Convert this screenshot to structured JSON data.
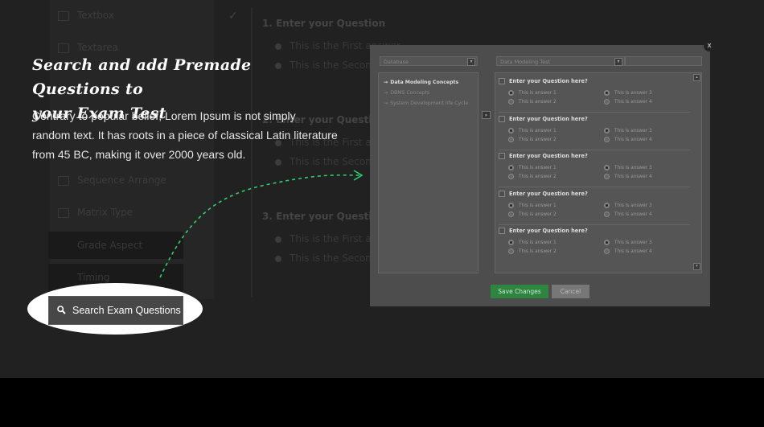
{
  "headline": {
    "line1": "Search and add Premade Questions to",
    "line2": "your Exam Test"
  },
  "description": {
    "line1": "Contrary to popular belief, Lorem Ipsum is not simply",
    "line2": "random text. It has roots in a piece of classical Latin literature",
    "line3": "from 45 BC, making it over 2000 years old."
  },
  "search_button": {
    "label": "Search Exam Questions",
    "icon": "search-icon"
  },
  "background": {
    "sidebar_items": [
      "Textbox",
      "Textarea",
      "Sequence Arrange",
      "Matrix Type"
    ],
    "sidebar_buttons": [
      "Grade Aspect",
      "Timing"
    ],
    "questions": [
      {
        "title": "1. Enter your Question",
        "answers": [
          "This is the First answer",
          "This is the Second"
        ]
      },
      {
        "title": "2. Enter your Question",
        "answers": [
          "This is the First ans",
          "This is the Second"
        ]
      },
      {
        "title": "3. Enter your Question",
        "answers": [
          "This is the First ans",
          "This is the Second"
        ]
      }
    ]
  },
  "modal": {
    "category_select": "Database",
    "test_select": "Data Modeling Test",
    "categories": [
      {
        "label": "Data Modeling Concepts",
        "active": true
      },
      {
        "label": "DBMS Concepts",
        "active": false
      },
      {
        "label": "System Development life Cycle",
        "active": false
      }
    ],
    "move_button": "»",
    "question_prompt": "Enter your Question here?",
    "answers": [
      "This is answer 1",
      "This is answer 2",
      "This is answer 3",
      "This is answer 4"
    ],
    "save_label": "Save Changes",
    "cancel_label": "Cancel",
    "close_label": "x"
  },
  "colors": {
    "save": "#2e8540",
    "arrow": "#2ecc71"
  }
}
